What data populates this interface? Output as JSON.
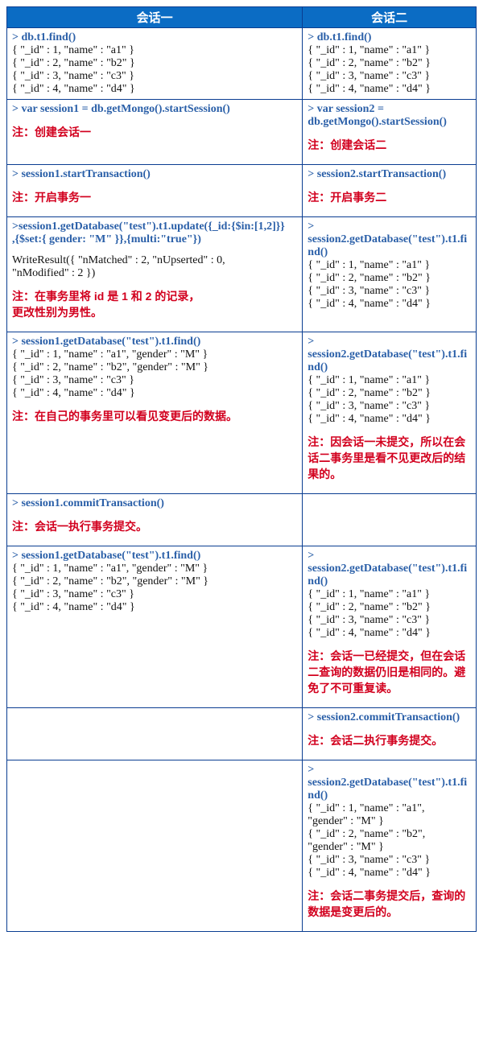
{
  "header": {
    "left": "会话一",
    "right": "会话二"
  },
  "r1": {
    "left": {
      "cmd": "> db.t1.find()",
      "lines": [
        "{ \"_id\" : 1, \"name\" : \"a1\" }",
        "{ \"_id\" : 2, \"name\" : \"b2\" }",
        "{ \"_id\" : 3, \"name\" : \"c3\" }",
        "{ \"_id\" : 4, \"name\" : \"d4\" }"
      ]
    },
    "right": {
      "cmd": "> db.t1.find()",
      "lines": [
        "{ \"_id\" : 1, \"name\" : \"a1\" }",
        "{ \"_id\" : 2, \"name\" : \"b2\" }",
        "{ \"_id\" : 3, \"name\" : \"c3\" }",
        "{ \"_id\" : 4, \"name\" : \"d4\" }"
      ]
    }
  },
  "r2": {
    "left": {
      "cmd": "> var session1 = db.getMongo().startSession()",
      "note": "注：创建会话一"
    },
    "right": {
      "cmd1": "> var session2 =",
      "cmd2": "db.getMongo().startSession()",
      "note": "注：创建会话二"
    }
  },
  "r3": {
    "left": {
      "cmd": "> session1.startTransaction()",
      "note": "注：开启事务一"
    },
    "right": {
      "cmd": "> session2.startTransaction()",
      "note": "注：开启事务二"
    }
  },
  "r4": {
    "left": {
      "cmd1": ">session1.getDatabase(\"test\").t1.update({_id:{$in:[1,2]}}",
      "cmd2": ",{$set:{ gender: \"M\" }},{multi:\"true\"})",
      "result1": "WriteResult({ \"nMatched\" : 2, \"nUpserted\" : 0,",
      "result2": "   \"nModified\" : 2 })",
      "note1": "注：在事务里将 id 是 1 和 2 的记录，",
      "note2": "更改性别为男性。"
    },
    "right": {
      "gt": ">",
      "cmd1": "session2.getDatabase(\"test\").t1.fi",
      "cmd2": "nd()",
      "lines": [
        "{ \"_id\" : 1, \"name\" : \"a1\" }",
        "{ \"_id\" : 2, \"name\" : \"b2\" }",
        "{ \"_id\" : 3, \"name\" : \"c3\" }",
        "{ \"_id\" : 4, \"name\" : \"d4\" }"
      ]
    }
  },
  "r5": {
    "left": {
      "cmd": "> session1.getDatabase(\"test\").t1.find()",
      "lines": [
        "{ \"_id\" : 1, \"name\" : \"a1\", \"gender\" : \"M\" }",
        "{ \"_id\" : 2, \"name\" : \"b2\", \"gender\" : \"M\" }",
        "{ \"_id\" : 3, \"name\" : \"c3\" }",
        "{ \"_id\" : 4, \"name\" : \"d4\" }"
      ],
      "note": "注：在自己的事务里可以看见变更后的数据。"
    },
    "right": {
      "gt": ">",
      "cmd1": "session2.getDatabase(\"test\").t1.fi",
      "cmd2": "nd()",
      "lines": [
        "{ \"_id\" : 1, \"name\" : \"a1\" }",
        "{ \"_id\" : 2, \"name\" : \"b2\" }",
        "{ \"_id\" : 3, \"name\" : \"c3\" }",
        "{ \"_id\" : 4, \"name\" : \"d4\" }"
      ],
      "note1": "注：因会话一未提交，所以在会",
      "note2": "话二事务里是看不见更改后的结",
      "note3": "果的。"
    }
  },
  "r6": {
    "left": {
      "cmd": "> session1.commitTransaction()",
      "note": "注：会话一执行事务提交。"
    }
  },
  "r7": {
    "left": {
      "cmd": "> session1.getDatabase(\"test\").t1.find()",
      "lines": [
        "{ \"_id\" : 1, \"name\" : \"a1\", \"gender\" : \"M\" }",
        "{ \"_id\" : 2, \"name\" : \"b2\", \"gender\" : \"M\" }",
        "{ \"_id\" : 3, \"name\" : \"c3\" }",
        "{ \"_id\" : 4, \"name\" : \"d4\" }"
      ]
    },
    "right": {
      "gt": ">",
      "cmd1": "session2.getDatabase(\"test\").t1.fi",
      "cmd2": "nd()",
      "lines": [
        "{ \"_id\" : 1, \"name\" : \"a1\" }",
        "{ \"_id\" : 2, \"name\" : \"b2\" }",
        "{ \"_id\" : 3, \"name\" : \"c3\" }",
        "{ \"_id\" : 4, \"name\" : \"d4\" }"
      ],
      "note1": "注：会话一已经提交，但在会话",
      "note2": "二查询的数据仍旧是相同的。避",
      "note3": "免了不可重复读。"
    }
  },
  "r8": {
    "right": {
      "cmd": "> session2.commitTransaction()",
      "note": "注：会话二执行事务提交。"
    }
  },
  "r9": {
    "right": {
      "gt": ">",
      "cmd1": "session2.getDatabase(\"test\").t1.fi",
      "cmd2": "nd()",
      "lines": [
        "{ \"_id\" : 1, \"name\" : \"a1\",",
        "\"gender\" : \"M\" }",
        "{ \"_id\" : 2, \"name\" : \"b2\",",
        "\"gender\" : \"M\" }",
        "{ \"_id\" : 3, \"name\" : \"c3\" }",
        "{ \"_id\" : 4, \"name\" : \"d4\" }"
      ],
      "note1": "注：会话二事务提交后，查询的",
      "note2": "数据是变更后的。"
    }
  }
}
